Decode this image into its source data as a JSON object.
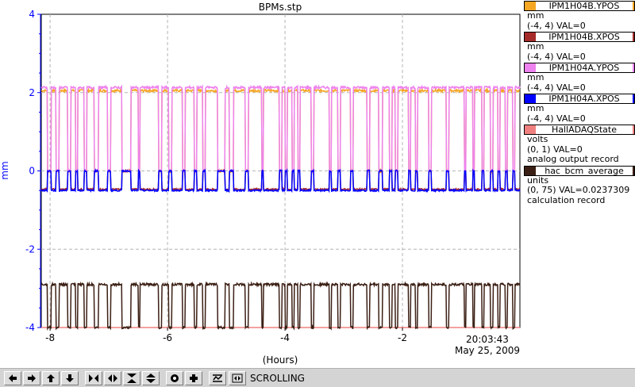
{
  "chart_data": {
    "type": "line",
    "title": "BPMs.stp",
    "xlabel": "(Hours)",
    "ylabel": "mm",
    "xlim": [
      -8.15,
      0
    ],
    "ylim": [
      -4,
      4
    ],
    "x_ticks": [
      -8,
      -6,
      -4,
      -2
    ],
    "x_tick_labels": [
      "-8",
      "-6",
      "-4",
      "-2"
    ],
    "y_ticks": [
      -4,
      -2,
      0,
      2,
      4
    ],
    "y_tick_labels": [
      "-4",
      "-2",
      "0",
      "2",
      "4"
    ],
    "end_time": "20:03:43",
    "end_date": "May 25, 2009",
    "grid": true,
    "legend_position": "right",
    "beam_off_intervals_hours": [
      [
        -8.05,
        -7.98
      ],
      [
        -7.9,
        -7.85
      ],
      [
        -7.7,
        -7.65
      ],
      [
        -7.57,
        -7.53
      ],
      [
        -7.42,
        -7.38
      ],
      [
        -7.25,
        -7.18
      ],
      [
        -7.02,
        -6.97
      ],
      [
        -6.78,
        -6.62
      ],
      [
        -6.5,
        -6.47
      ],
      [
        -6.15,
        -6.1
      ],
      [
        -5.98,
        -5.93
      ],
      [
        -5.75,
        -5.7
      ],
      [
        -5.55,
        -5.5
      ],
      [
        -5.4,
        -5.36
      ],
      [
        -5.15,
        -5.02
      ],
      [
        -4.95,
        -4.88
      ],
      [
        -4.68,
        -4.62
      ],
      [
        -4.4,
        -4.37
      ],
      [
        -4.1,
        -4.05
      ],
      [
        -4.0,
        -3.96
      ],
      [
        -3.88,
        -3.84
      ],
      [
        -3.78,
        -3.74
      ],
      [
        -3.55,
        -3.51
      ],
      [
        -3.25,
        -3.21
      ],
      [
        -3.1,
        -3.06
      ],
      [
        -2.88,
        -2.84
      ],
      [
        -2.6,
        -2.56
      ],
      [
        -2.4,
        -2.34
      ],
      [
        -2.22,
        -2.18
      ],
      [
        -2.12,
        -2.08
      ],
      [
        -1.9,
        -1.86
      ],
      [
        -1.78,
        -1.74
      ],
      [
        -1.55,
        -1.51
      ],
      [
        -1.25,
        -1.21
      ],
      [
        -0.95,
        -0.92
      ],
      [
        -0.8,
        -0.77
      ],
      [
        -0.65,
        -0.61
      ],
      [
        -0.5,
        -0.46
      ],
      [
        -0.38,
        -0.34
      ],
      [
        -0.25,
        -0.21
      ],
      [
        -0.12,
        -0.09
      ]
    ],
    "series": [
      {
        "name": "IPM1H04B.YPOS",
        "color": "#f5a623",
        "beam_on_value": 2.05,
        "beam_off_value": 0,
        "noise": 0.03
      },
      {
        "name": "IPM1H04B.XPOS",
        "color": "#a52a2a",
        "beam_on_value": -0.47,
        "beam_off_value": 0,
        "noise": 0.02
      },
      {
        "name": "IPM1H04A.YPOS",
        "color": "#ee82ee",
        "beam_on_value": 2.13,
        "beam_off_value": 0,
        "noise": 0.03
      },
      {
        "name": "IPM1H04A.XPOS",
        "color": "#0000ff",
        "beam_on_value": -0.5,
        "beam_off_value": 0,
        "noise": 0.02
      },
      {
        "name": "HallADAQState",
        "color": "#f08080",
        "beam_on_value": -4.0,
        "beam_off_value": -4.0,
        "noise": 0
      },
      {
        "name": "hac_bcm_average",
        "color": "#3b1f14",
        "beam_on_value": -2.9,
        "beam_off_value": -4.0,
        "noise": 0.03
      }
    ]
  },
  "legend": [
    {
      "name": "IPM1H04B.YPOS",
      "color": "#f5a623",
      "lines": [
        "mm",
        "(-4, 4) VAL=0"
      ]
    },
    {
      "name": "IPM1H04B.XPOS",
      "color": "#a52a2a",
      "lines": [
        "mm",
        "(-4, 4) VAL=0"
      ]
    },
    {
      "name": "IPM1H04A.YPOS",
      "color": "#ee82ee",
      "lines": [
        "mm",
        "(-4, 4) VAL=0"
      ]
    },
    {
      "name": "IPM1H04A.XPOS",
      "color": "#0000ff",
      "lines": [
        "mm",
        "(-4, 4) VAL=0"
      ]
    },
    {
      "name": "HallADAQState",
      "color": "#f08080",
      "lines": [
        "volts",
        "(0, 1) VAL=0",
        "analog output record"
      ]
    },
    {
      "name": "hac_bcm_average",
      "color": "#3b1f14",
      "lines": [
        "units",
        "(0, 75) VAL=0.0237309",
        "calculation record"
      ]
    }
  ],
  "toolbar": {
    "buttons": [
      {
        "icon": "arrow-left-icon"
      },
      {
        "icon": "arrow-right-icon"
      },
      {
        "icon": "arrow-up-icon"
      },
      {
        "icon": "arrow-down-icon"
      },
      {
        "icon": "zoom-in-horizontal-icon"
      },
      {
        "icon": "zoom-out-horizontal-icon"
      },
      {
        "icon": "zoom-in-vertical-icon"
      },
      {
        "icon": "zoom-out-vertical-icon"
      },
      {
        "icon": "autoscale-icon"
      },
      {
        "icon": "reset-icon"
      },
      {
        "icon": "toggle-grid-icon"
      },
      {
        "icon": "scroll-mode-icon"
      }
    ],
    "status": "SCROLLING"
  }
}
